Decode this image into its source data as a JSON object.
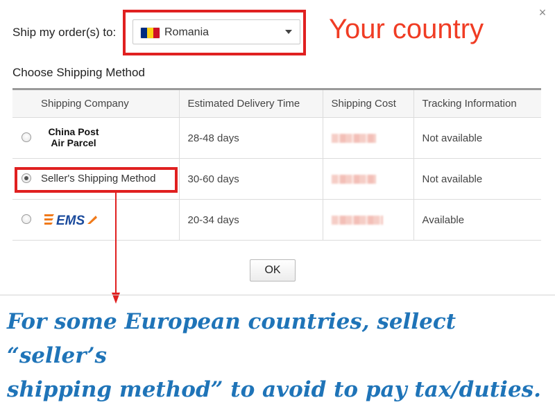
{
  "dialog": {
    "close_label": "×"
  },
  "ship_to": {
    "label": "Ship my order(s) to:",
    "selected_country": "Romania",
    "flag_colors": [
      "#002b7f",
      "#fcd116",
      "#ce1126"
    ]
  },
  "section_title": "Choose Shipping Method",
  "table": {
    "headers": [
      "Shipping Company",
      "Estimated Delivery Time",
      "Shipping Cost",
      "Tracking Information"
    ],
    "rows": [
      {
        "company_logo_text": [
          "China Post",
          "Air Parcel"
        ],
        "selected": false,
        "delivery_time": "28-48 days",
        "tracking": "Not available"
      },
      {
        "company": "Seller's Shipping Method",
        "selected": true,
        "delivery_time": "30-60 days",
        "tracking": "Not available"
      },
      {
        "company_logo_text": "EMS",
        "selected": false,
        "delivery_time": "20-34 days",
        "tracking": "Available"
      }
    ]
  },
  "ok_label": "OK",
  "annotations": {
    "country": "Your country",
    "note_line1": "For some European countries, sellect “seller’s",
    "note_line2": "shipping method” to avoid to pay tax/duties."
  },
  "colors": {
    "highlight_red": "#e02020",
    "annotation_orange": "#f03c24",
    "annotation_blue": "#1f74b8",
    "ems_blue": "#1a4a9c",
    "ems_orange": "#f07a1a"
  }
}
